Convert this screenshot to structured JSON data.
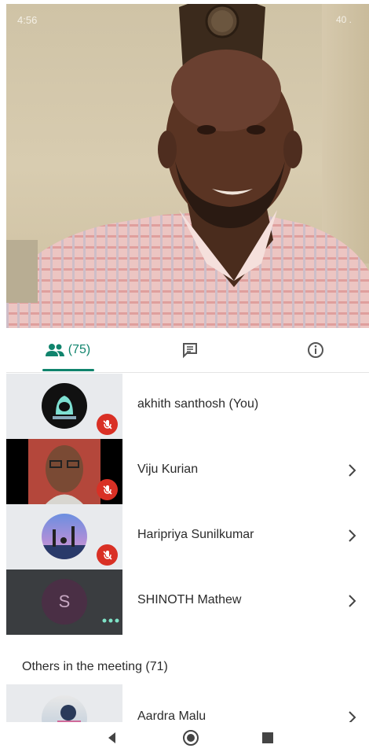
{
  "status_bar": {
    "time": "4:56",
    "right": "40 ."
  },
  "tabs": {
    "people_count": "(75)",
    "active": "people"
  },
  "participants": [
    {
      "name": "akhith santhosh (You)",
      "muted": true,
      "avatar_text": ""
    },
    {
      "name": "Viju Kurian",
      "muted": true
    },
    {
      "name": "Haripriya Sunilkumar",
      "muted": true
    },
    {
      "name": "SHINOTH Mathew",
      "muted": false,
      "avatar_letter": "S"
    }
  ],
  "others": {
    "title": "Others in the meeting (71)",
    "items": [
      {
        "name": "Aardra Malu"
      }
    ]
  },
  "colors": {
    "accent": "#10846d",
    "muted_badge": "#d93025",
    "tile_dark": "#3a3d40"
  },
  "icons": [
    "people-icon",
    "chat-icon",
    "info-icon",
    "mic-off-icon",
    "chevron-right-icon",
    "back-icon",
    "home-icon",
    "recents-icon"
  ]
}
